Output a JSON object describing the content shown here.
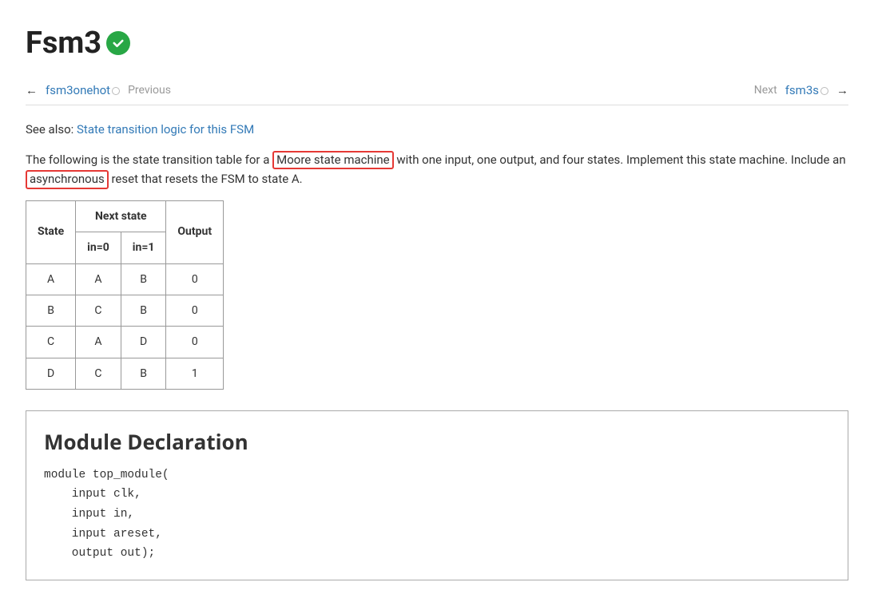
{
  "title": "Fsm3",
  "nav": {
    "prev_link": "fsm3onehot",
    "prev_label": "Previous",
    "next_label": "Next",
    "next_link": "fsm3s"
  },
  "see_also": {
    "prefix": "See also: ",
    "link_text": "State transition logic for this FSM"
  },
  "desc": {
    "p1_a": "The following is the state transition table for a ",
    "hl1": "Moore state machine",
    "p1_b": " with one input, one output, and four states. Implement this state machine. Include an ",
    "hl2": "asynchronous",
    "p1_c": " reset that resets the FSM to state A."
  },
  "table": {
    "headers": {
      "state": "State",
      "next_state": "Next state",
      "in0": "in=0",
      "in1": "in=1",
      "output": "Output"
    },
    "rows": [
      {
        "state": "A",
        "in0": "A",
        "in1": "B",
        "out": "0"
      },
      {
        "state": "B",
        "in0": "C",
        "in1": "B",
        "out": "0"
      },
      {
        "state": "C",
        "in0": "A",
        "in1": "D",
        "out": "0"
      },
      {
        "state": "D",
        "in0": "C",
        "in1": "B",
        "out": "1"
      }
    ]
  },
  "module": {
    "heading": "Module Declaration",
    "code": "module top_module(\n    input clk,\n    input in,\n    input areset,\n    output out);"
  }
}
